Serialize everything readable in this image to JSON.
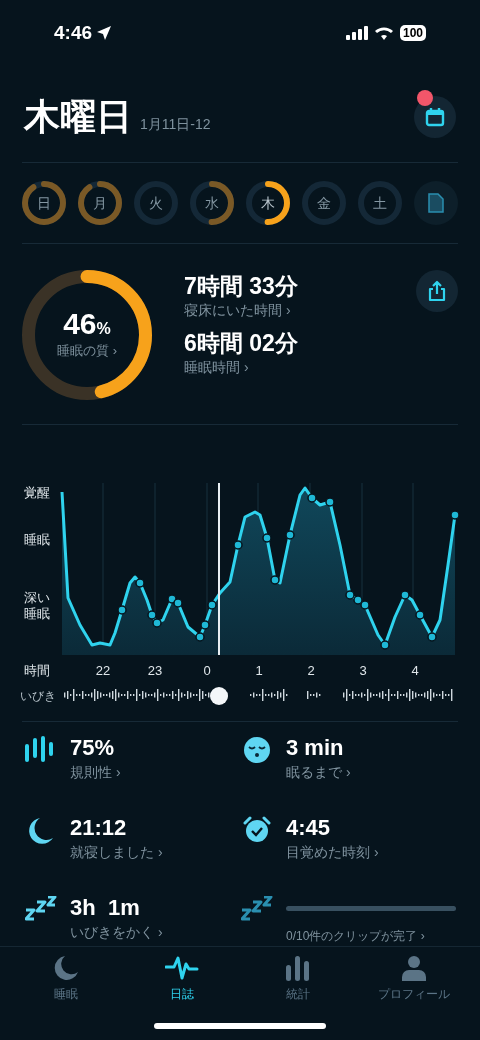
{
  "status_bar": {
    "time": "4:46",
    "battery": "100"
  },
  "header": {
    "title": "木曜日",
    "date_range": "1月11日-12",
    "calendar_badge": true
  },
  "days": [
    {
      "label": "日",
      "selected": false
    },
    {
      "label": "月",
      "selected": false
    },
    {
      "label": "火",
      "selected": false
    },
    {
      "label": "水",
      "selected": false
    },
    {
      "label": "木",
      "selected": true
    },
    {
      "label": "金",
      "selected": false
    },
    {
      "label": "土",
      "selected": false
    }
  ],
  "quality": {
    "value": "46",
    "unit": "%",
    "label": "睡眠の質 ›"
  },
  "durations": [
    {
      "value": "7時間 33分",
      "label": "寝床にいた時間 ›"
    },
    {
      "value": "6時間 02分",
      "label": "睡眠時間 ›"
    }
  ],
  "chart": {
    "y_labels": [
      "覚醒",
      "睡眠",
      "深い睡眠"
    ],
    "x_title": "時間",
    "x_ticks": [
      "22",
      "23",
      "0",
      "1",
      "2",
      "3",
      "4"
    ],
    "snore_label": "いびき"
  },
  "stats": [
    {
      "kind": "metric",
      "value": "75%",
      "label": "規則性 ›"
    },
    {
      "kind": "metric",
      "value": "3 min",
      "label": "眠るまで ›"
    },
    {
      "kind": "metric",
      "value": "21:12",
      "label": "就寝しました ›"
    },
    {
      "kind": "metric",
      "value": "4:45",
      "label": "目覚めた時刻 ›"
    },
    {
      "kind": "metric",
      "value": "3h  1m",
      "label": "いびきをかく ›"
    },
    {
      "kind": "progress",
      "level": 0,
      "label": "0/10件のクリップが完了 ›"
    }
  ],
  "tabs": [
    {
      "label": "睡眠",
      "selected": false
    },
    {
      "label": "日誌",
      "selected": true
    },
    {
      "label": "統計",
      "selected": false
    },
    {
      "label": "プロフィール",
      "selected": false
    }
  ]
}
